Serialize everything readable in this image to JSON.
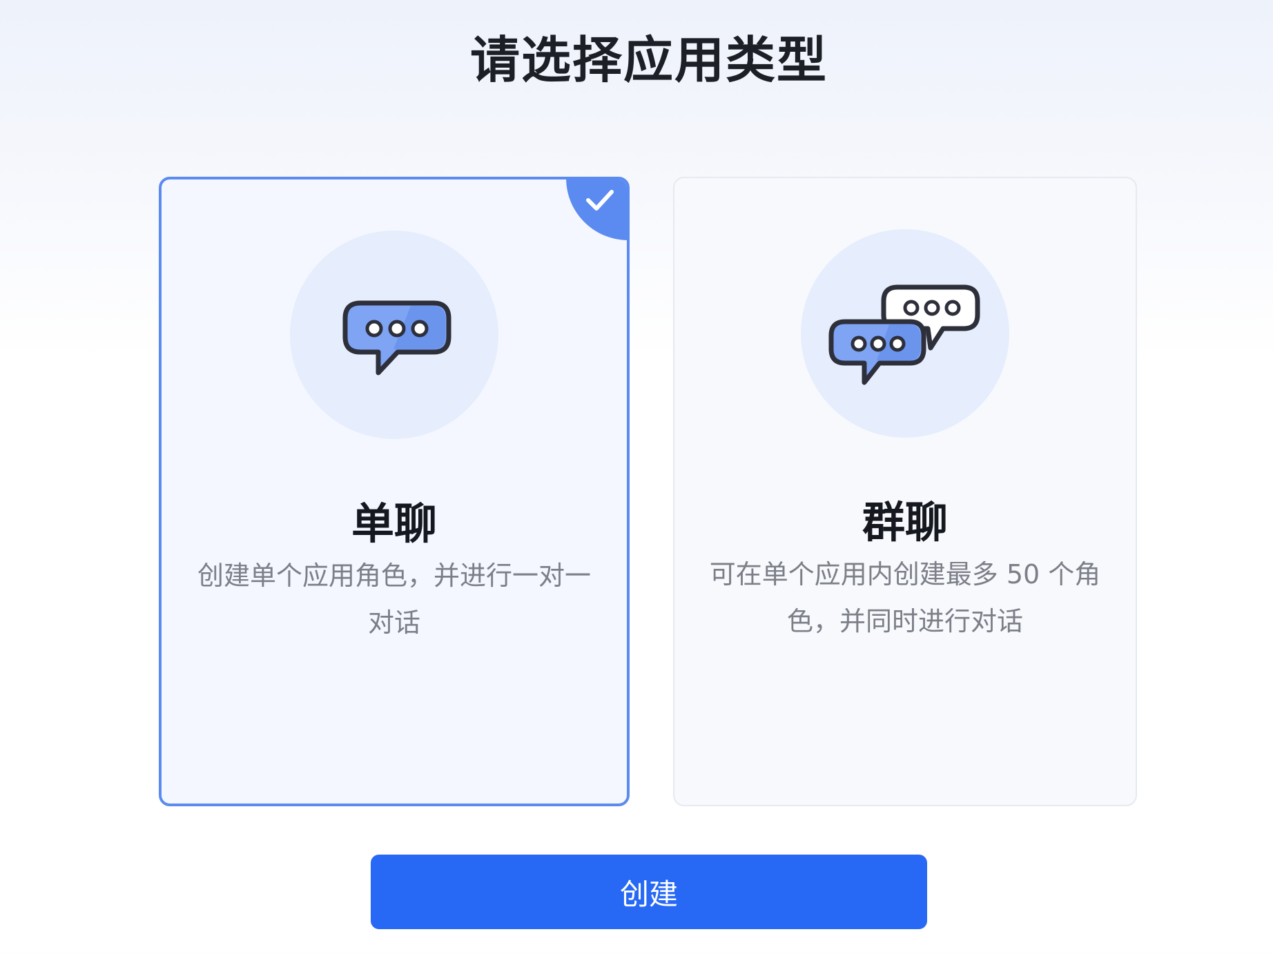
{
  "header": {
    "title": "请选择应用类型"
  },
  "options": [
    {
      "title": "单聊",
      "description": "创建单个应用角色，并进行一对一对话",
      "selected": true,
      "icon": "single-chat-bubble-icon"
    },
    {
      "title": "群聊",
      "description": "可在单个应用内创建最多 50 个角色，并同时进行对话",
      "selected": false,
      "icon": "group-chat-bubbles-icon"
    }
  ],
  "actions": {
    "create_label": "创建"
  },
  "colors": {
    "accent": "#2769f4",
    "selected_border": "#5b8bf0",
    "bubble_fill": "#7fa4f3",
    "icon_outline": "#2d2f3a"
  }
}
